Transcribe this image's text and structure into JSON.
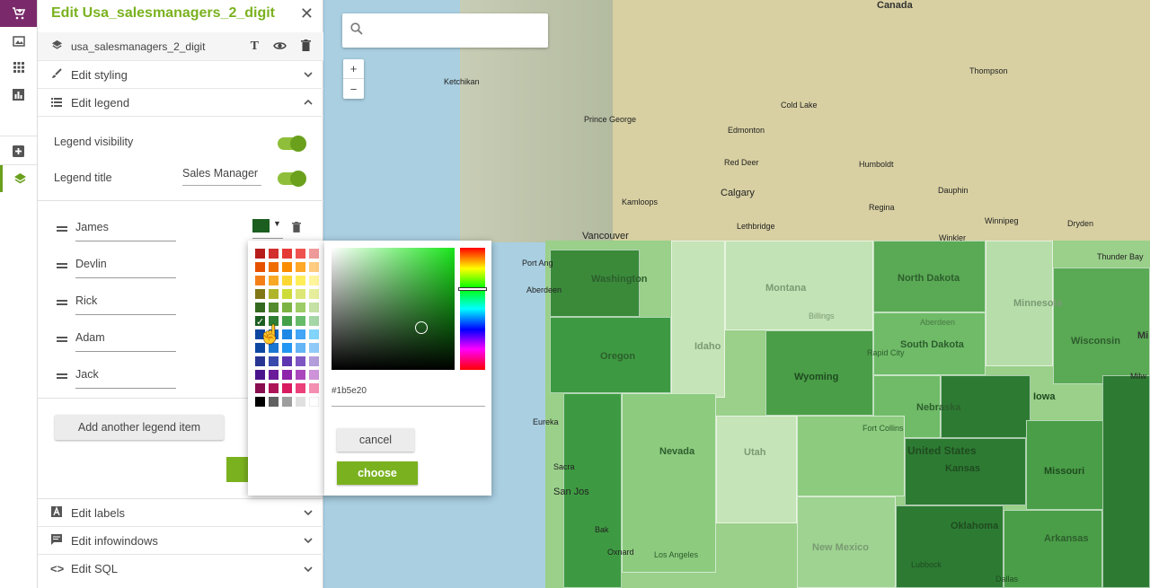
{
  "rail": {
    "items": [
      {
        "name": "basket",
        "icon": "shopping-cart-icon"
      },
      {
        "name": "maps",
        "icon": "image-icon"
      },
      {
        "name": "apps",
        "icon": "grid-icon"
      },
      {
        "name": "charts",
        "icon": "bar-chart-icon"
      },
      {
        "name": "add",
        "icon": "plus-box-icon"
      },
      {
        "name": "layers",
        "icon": "layers-icon"
      }
    ]
  },
  "panel": {
    "title": "Edit Usa_salesmanagers_2_digit",
    "layer_name": "usa_salesmanagers_2_digit",
    "sections": {
      "styling": "Edit styling",
      "legend": "Edit legend",
      "labels": "Edit labels",
      "infowindows": "Edit infowindows",
      "sql": "Edit SQL"
    },
    "legend_visibility_label": "Legend visibility",
    "legend_visibility": true,
    "legend_title_label": "Legend title",
    "legend_title_value": "Sales Manager",
    "legend_title_enabled": true,
    "legend_items": [
      "James",
      "Devlin",
      "Rick",
      "Adam",
      "Jack"
    ],
    "selected_swatch_color": "#1b5e20",
    "add_item_label": "Add another legend item"
  },
  "palette": {
    "colors": [
      "#b71c1c",
      "#d32f2f",
      "#e53935",
      "#ef5350",
      "#ef9a9a",
      "#e65100",
      "#ef6c00",
      "#fb8c00",
      "#ffa726",
      "#ffcc80",
      "#f57f17",
      "#f9a825",
      "#fdd835",
      "#ffee58",
      "#fff59d",
      "#827717",
      "#afb42b",
      "#cddc39",
      "#dce775",
      "#e6ee9c",
      "#33691e",
      "#558b2f",
      "#7cb342",
      "#9ccc65",
      "#c5e1a5",
      "#1b5e20",
      "#2e7d32",
      "#43a047",
      "#66bb6a",
      "#a5d6a7",
      "#0d47a1",
      "#1565c0",
      "#1e88e5",
      "#42a5f5",
      "#81d4fa",
      "#0d47a1",
      "#1976d2",
      "#2196f3",
      "#64b5f6",
      "#90caf9",
      "#283593",
      "#3949ab",
      "#5e35b1",
      "#7e57c2",
      "#b39ddb",
      "#4a148c",
      "#6a1b9a",
      "#8e24aa",
      "#ab47bc",
      "#ce93d8",
      "#880e4f",
      "#ad1457",
      "#d81b60",
      "#ec407a",
      "#f48fb1",
      "#000000",
      "#616161",
      "#9e9e9e",
      "#e0e0e0",
      "#ffffff"
    ]
  },
  "picker": {
    "hex_value": "#1b5e20",
    "cancel_label": "cancel",
    "choose_label": "choose"
  },
  "map": {
    "search_placeholder": "",
    "zoom_in": "+",
    "zoom_out": "−",
    "labels": {
      "canada": "Canada",
      "ketchikan": "Ketchikan",
      "prince_george": "Prince George",
      "edmonton": "Edmonton",
      "cold_lake": "Cold Lake",
      "thompson": "Thompson",
      "red_deer": "Red Deer",
      "humboldt": "Humboldt",
      "calgary": "Calgary",
      "dauphin": "Dauphin",
      "kamloops": "Kamloops",
      "regina": "Regina",
      "lethbridge": "Lethbridge",
      "winnipeg": "Winnipeg",
      "dryden": "Dryden",
      "vancouver": "Vancouver",
      "winkler": "Winkler",
      "thunder_bay": "Thunder Bay",
      "port_angeles": "Port Ang",
      "aberdeen": "Aberdeen",
      "washington": "Washington",
      "montana": "Montana",
      "north_dakota": "North Dakota",
      "minnesota": "Minnesota",
      "billings": "Billings",
      "aberdeen_sd": "Aberdeen",
      "oregon": "Oregon",
      "idaho": "Idaho",
      "south_dakota": "South Dakota",
      "wisconsin": "Wisconsin",
      "rapid_city": "Rapid City",
      "wyoming": "Wyoming",
      "iowa": "Iowa",
      "nebraska": "Nebraska",
      "eureka": "Eureka",
      "fort_collins": "Fort Collins",
      "nevada": "Nevada",
      "united_states": "United States",
      "utah": "Utah",
      "kansas": "Kansas",
      "missouri": "Missouri",
      "sacramento": "Sacra",
      "san_jose": "San Jos",
      "bakersfield": "Bak",
      "oxnard": "Oxnard",
      "los_angeles": "Los Angeles",
      "new_mexico": "New Mexico",
      "oklahoma": "Oklahoma",
      "arkansas": "Arkansas",
      "lubbock": "Lubbock",
      "dallas": "Dallas",
      "milwaukee": "Milw",
      "mi": "Mi"
    }
  }
}
